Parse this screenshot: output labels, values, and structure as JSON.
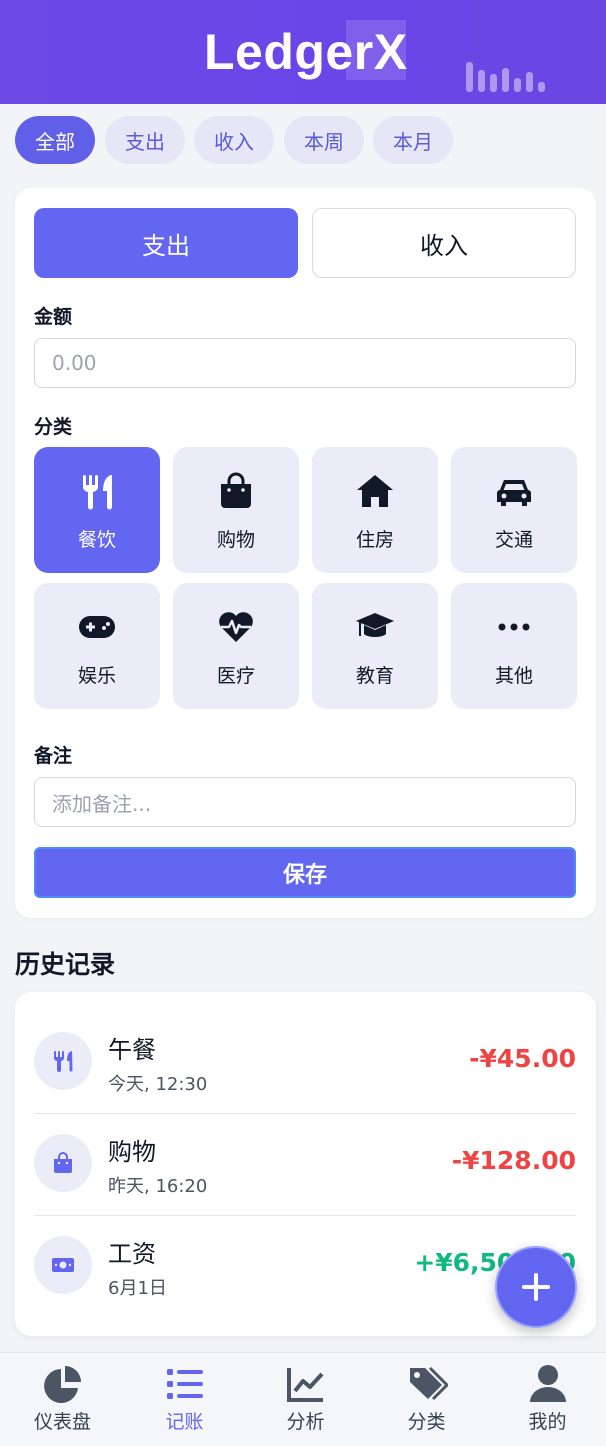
{
  "app": {
    "title": "LedgerX"
  },
  "filters": [
    {
      "label": "全部",
      "active": true
    },
    {
      "label": "支出",
      "active": false
    },
    {
      "label": "收入",
      "active": false
    },
    {
      "label": "本周",
      "active": false
    },
    {
      "label": "本月",
      "active": false
    }
  ],
  "form": {
    "type_toggle": {
      "expense_label": "支出",
      "income_label": "收入",
      "selected": "支出"
    },
    "amount_label": "金额",
    "amount_placeholder": "0.00",
    "category_label": "分类",
    "categories": [
      {
        "label": "餐饮",
        "icon": "utensils-icon",
        "active": true
      },
      {
        "label": "购物",
        "icon": "shopping-bag-icon",
        "active": false
      },
      {
        "label": "住房",
        "icon": "home-icon",
        "active": false
      },
      {
        "label": "交通",
        "icon": "car-icon",
        "active": false
      },
      {
        "label": "娱乐",
        "icon": "gamepad-icon",
        "active": false
      },
      {
        "label": "医疗",
        "icon": "heart-pulse-icon",
        "active": false
      },
      {
        "label": "教育",
        "icon": "graduation-cap-icon",
        "active": false
      },
      {
        "label": "其他",
        "icon": "more-icon",
        "active": false
      }
    ],
    "note_label": "备注",
    "note_placeholder": "添加备注...",
    "save_label": "保存"
  },
  "history": {
    "title": "历史记录",
    "items": [
      {
        "title": "午餐",
        "time": "今天, 12:30",
        "amount": "-¥45.00",
        "icon": "utensils-icon",
        "kind": "expense"
      },
      {
        "title": "购物",
        "time": "昨天, 16:20",
        "amount": "-¥128.00",
        "icon": "shopping-bag-icon",
        "kind": "expense"
      },
      {
        "title": "工资",
        "time": "6月1日",
        "amount": "+¥6,500.00",
        "icon": "money-bill-icon",
        "kind": "income"
      }
    ]
  },
  "fab": {
    "icon": "plus-icon"
  },
  "nav": [
    {
      "label": "仪表盘",
      "icon": "pie-chart-icon",
      "active": false
    },
    {
      "label": "记账",
      "icon": "list-icon",
      "active": true
    },
    {
      "label": "分析",
      "icon": "line-chart-icon",
      "active": false
    },
    {
      "label": "分类",
      "icon": "tags-icon",
      "active": false
    },
    {
      "label": "我的",
      "icon": "user-icon",
      "active": false
    }
  ],
  "colors": {
    "brand": "#6366f1",
    "header": "#6a45e8",
    "expense": "#ef4444",
    "income": "#10b981"
  }
}
